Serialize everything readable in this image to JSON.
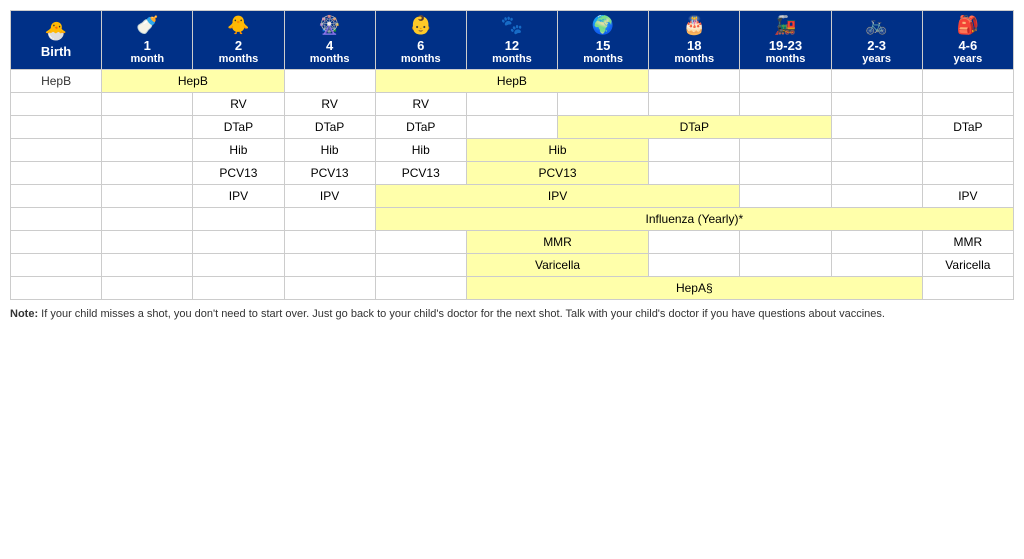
{
  "header": {
    "columns": [
      {
        "id": "birth",
        "icon": "🐣",
        "line1": "Birth",
        "line2": ""
      },
      {
        "id": "1m",
        "icon": "🍼",
        "line1": "1",
        "line2": "month"
      },
      {
        "id": "2m",
        "icon": "🐥",
        "line1": "2",
        "line2": "months"
      },
      {
        "id": "4m",
        "icon": "🎡",
        "line1": "4",
        "line2": "months"
      },
      {
        "id": "6m",
        "icon": "👶",
        "line1": "6",
        "line2": "months"
      },
      {
        "id": "12m",
        "icon": "🐾",
        "line1": "12",
        "line2": "months"
      },
      {
        "id": "15m",
        "icon": "🌐",
        "line1": "15",
        "line2": "months"
      },
      {
        "id": "18m",
        "icon": "🎂",
        "line1": "18",
        "line2": "months"
      },
      {
        "id": "1923m",
        "icon": "🚂",
        "line1": "19-23",
        "line2": "months"
      },
      {
        "id": "23y",
        "icon": "🚲",
        "line1": "2-3",
        "line2": "years"
      },
      {
        "id": "46y",
        "icon": "🎒",
        "line1": "4-6",
        "line2": "years"
      }
    ]
  },
  "vaccines": [
    {
      "name": "HepB",
      "cells": [
        {
          "col": "birth",
          "text": "",
          "yellow": false
        },
        {
          "col": "1m",
          "text": "HepB",
          "yellow": true,
          "colspan": 2
        },
        {
          "col": "2m",
          "skip": true
        },
        {
          "col": "4m",
          "text": "",
          "yellow": false
        },
        {
          "col": "6m",
          "text": "HepB",
          "yellow": true,
          "colspan": 3
        },
        {
          "col": "12m",
          "skip": true
        },
        {
          "col": "15m",
          "skip": true
        },
        {
          "col": "18m",
          "text": "",
          "yellow": false
        },
        {
          "col": "1923m",
          "text": "",
          "yellow": false
        },
        {
          "col": "23y",
          "text": "",
          "yellow": false
        },
        {
          "col": "46y",
          "text": "",
          "yellow": false
        }
      ]
    }
  ],
  "note": "If your child misses a shot, you don't need to start over. Just go back to your child's doctor for the next shot. Talk with your child's doctor if you have questions about vaccines.",
  "note_label": "Note:"
}
